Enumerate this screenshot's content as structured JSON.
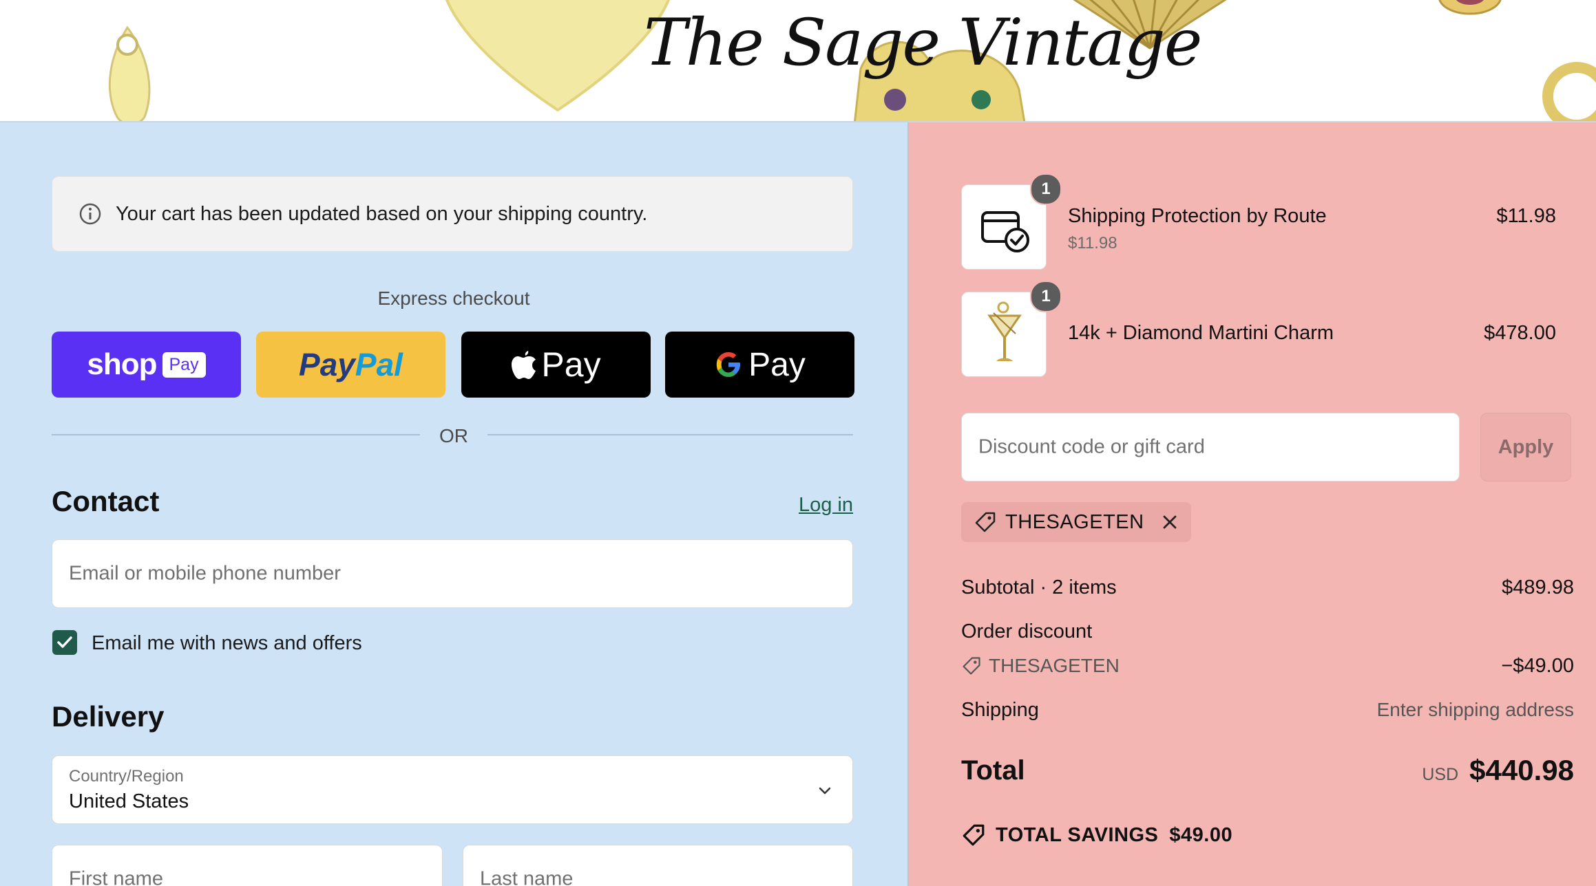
{
  "header": {
    "logo_text": "The Sage Vintage"
  },
  "notice": {
    "text": "Your cart has been updated based on your shipping country."
  },
  "express": {
    "label": "Express checkout",
    "shop_pay": {
      "word": "shop",
      "pill": "Pay"
    },
    "paypal": {
      "part1": "Pay",
      "part2": "Pal"
    },
    "apple_pay": {
      "word": "Pay"
    },
    "google_pay": {
      "word": "Pay"
    }
  },
  "or_text": "OR",
  "contact": {
    "heading": "Contact",
    "login_label": "Log in",
    "email_placeholder": "Email or mobile phone number",
    "newsletter_label": "Email me with news and offers",
    "newsletter_checked": true
  },
  "delivery": {
    "heading": "Delivery",
    "country_label": "Country/Region",
    "country_value": "United States",
    "first_name_placeholder": "First name",
    "last_name_placeholder": "Last name"
  },
  "cart": {
    "items": [
      {
        "quantity": "1",
        "title": "Shipping Protection by Route",
        "subtitle": "$11.98",
        "price": "$11.98",
        "icon": "shipping-protection-icon"
      },
      {
        "quantity": "1",
        "title": "14k + Diamond Martini Charm",
        "subtitle": "",
        "price": "$478.00",
        "icon": "martini-charm-image"
      }
    ],
    "discount_placeholder": "Discount code or gift card",
    "apply_label": "Apply",
    "applied_code": "THESAGETEN"
  },
  "summary": {
    "subtotal_label": "Subtotal · 2 items",
    "subtotal_value": "$489.98",
    "order_discount_label": "Order discount",
    "discount_code": "THESAGETEN",
    "discount_value": "−$49.00",
    "shipping_label": "Shipping",
    "shipping_value": "Enter shipping address",
    "total_label": "Total",
    "currency": "USD",
    "total_value": "$440.98",
    "savings_label": "TOTAL SAVINGS",
    "savings_value": "$49.00"
  },
  "colors": {
    "left_bg": "#cfe3f7",
    "right_bg": "#f4b6b3",
    "shop_pay": "#5a31f4",
    "paypal": "#f5c244",
    "accent": "#1f5a4b"
  }
}
